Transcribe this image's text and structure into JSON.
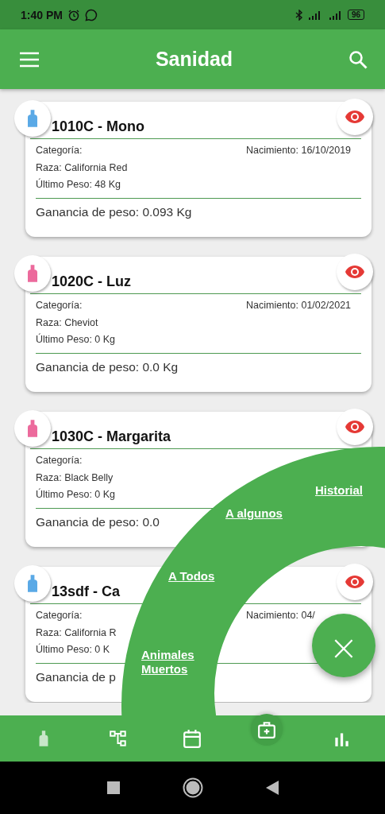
{
  "status_bar": {
    "time": "1:40 PM",
    "battery": "96"
  },
  "app_bar": {
    "title": "Sanidad"
  },
  "animals": [
    {
      "name": "1010C - Mono",
      "color": "#5aa9e6",
      "category": "Categoría:",
      "birth": "Nacimiento: 16/10/2019",
      "breed": "Raza: California Red",
      "weight": "Último Peso: 48 Kg",
      "gain": "Ganancia de peso: 0.093 Kg"
    },
    {
      "name": "1020C - Luz",
      "color": "#ec6a9c",
      "category": "Categoría:",
      "birth": "Nacimiento: 01/02/2021",
      "breed": "Raza: Cheviot",
      "weight": "Último Peso: 0 Kg",
      "gain": "Ganancia de peso: 0.0 Kg"
    },
    {
      "name": "1030C - Margarita",
      "color": "#ec6a9c",
      "category": "Categoría:",
      "breed": "Raza: Black Belly",
      "weight": "Último Peso: 0 Kg",
      "gain": "Ganancia de peso: 0.0"
    },
    {
      "name": "13sdf - Ca",
      "color": "#5aa9e6",
      "category": "Categoría:",
      "birth": "Nacimiento: 04/",
      "breed": "Raza: California R",
      "weight": "Último Peso: 0 K",
      "gain": "Ganancia de p"
    }
  ],
  "menu": {
    "items": [
      {
        "label": "Historial"
      },
      {
        "label": "A algunos"
      },
      {
        "label": "A Todos"
      },
      {
        "label": "Animales Muertos"
      }
    ],
    "close": "×"
  },
  "bottom_nav": [
    {
      "kind": "tag",
      "selected": false
    },
    {
      "kind": "tree",
      "selected": false
    },
    {
      "kind": "calendar",
      "selected": false
    },
    {
      "kind": "medical",
      "selected": true
    },
    {
      "kind": "chart",
      "selected": false
    }
  ]
}
